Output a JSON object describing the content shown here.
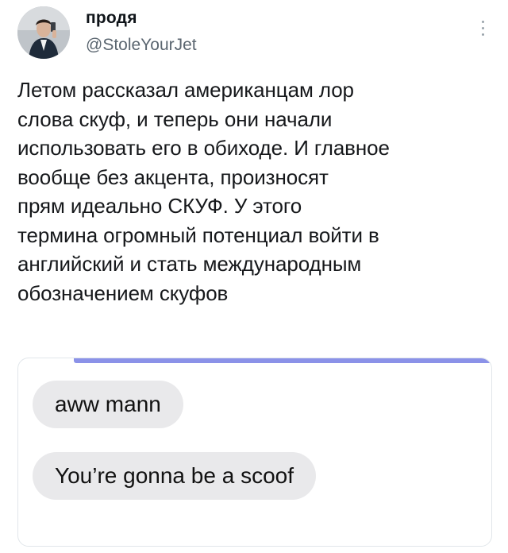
{
  "author": {
    "display_name": "продя",
    "handle": "@StoleYourJet"
  },
  "tweet": {
    "lines": [
      "Летом рассказал американцам лор",
      "слова скуф, и теперь они начали",
      "использовать его в обиходе. И главное",
      "вообще без акцента, произносят",
      "прям идеально СКУФ. У этого",
      "термина огромный потенциал войти в",
      "английский и стать международным",
      "обозначением скуфов"
    ]
  },
  "media": {
    "messages": [
      "aww mann",
      "You’re gonna be a scoof"
    ],
    "bubble_color": "#e9e9eb",
    "accent_bar_color": "#8b92e8"
  },
  "icons": {
    "menu": "more-vertical-icon",
    "avatar": "avatar-photo"
  }
}
